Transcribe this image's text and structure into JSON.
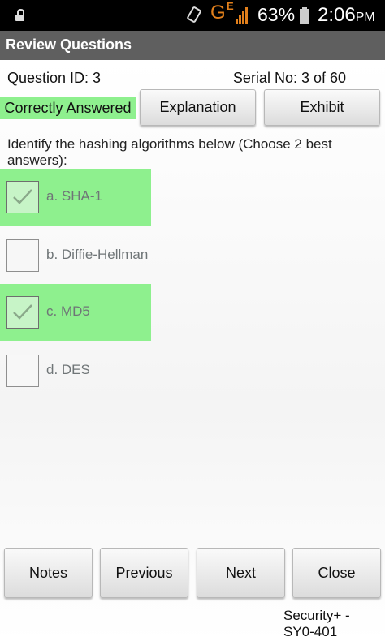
{
  "status_bar": {
    "network_type": "G",
    "network_sub": "E",
    "battery_percent": "63%",
    "time": "2:06",
    "ampm": "PM",
    "icons": [
      "lock-icon",
      "rotate-icon",
      "signal-icon",
      "battery-icon"
    ]
  },
  "titlebar": {
    "title": "Review Questions"
  },
  "header": {
    "question_id": "Question ID: 3",
    "serial": "Serial No: 3 of 60",
    "result": "Correctly Answered",
    "explanation_label": "Explanation",
    "exhibit_label": "Exhibit"
  },
  "question": {
    "text": "Identify the hashing algorithms below (Choose 2 best answers):",
    "options": [
      {
        "label": "a. SHA-1",
        "checked": true,
        "correct": true
      },
      {
        "label": "b. Diffie-Hellman",
        "checked": false,
        "correct": false
      },
      {
        "label": "c. MD5",
        "checked": true,
        "correct": true
      },
      {
        "label": "d. DES",
        "checked": false,
        "correct": false
      }
    ]
  },
  "nav": {
    "notes": "Notes",
    "previous": "Previous",
    "next": "Next",
    "close": "Close"
  },
  "footer": {
    "exam": "Security+ - SY0-401"
  },
  "colors": {
    "correct_highlight": "#8ef08e",
    "titlebar": "#5f5f5f",
    "statusbar": "#000000",
    "network_accent": "#e2801c"
  }
}
